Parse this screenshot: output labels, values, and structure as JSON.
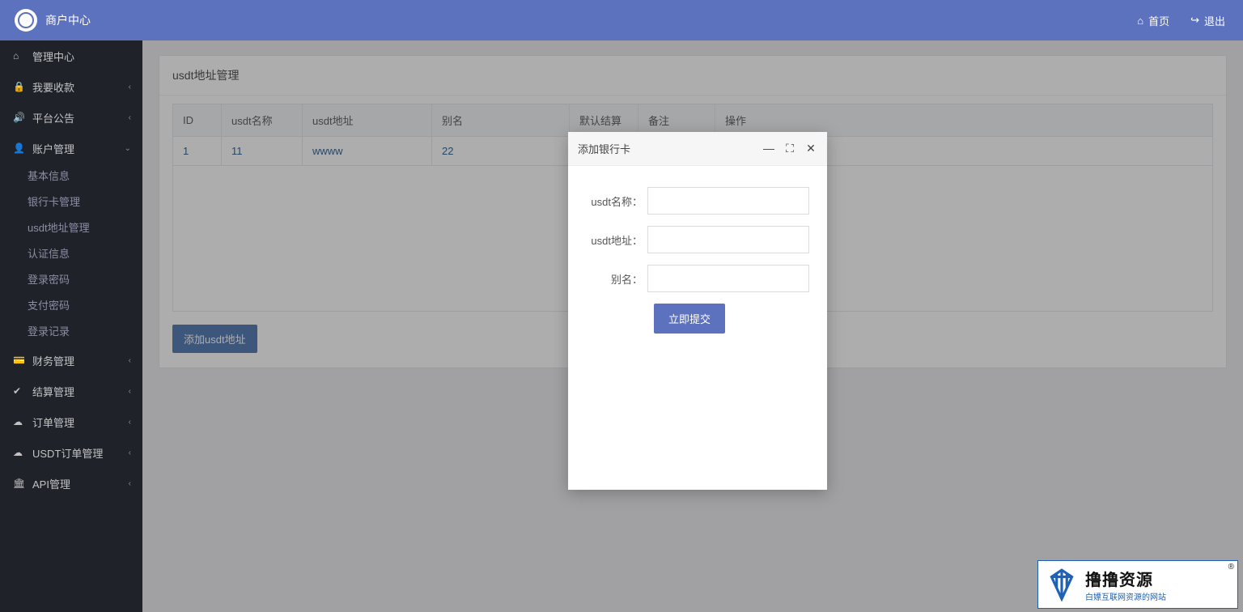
{
  "header": {
    "title": "商户中心",
    "home_label": "首页",
    "logout_label": "退出"
  },
  "sidebar": {
    "items": [
      {
        "icon": "⌂",
        "label": "管理中心",
        "chevron": ""
      },
      {
        "icon": "🔒",
        "label": "我要收款",
        "chevron": "‹"
      },
      {
        "icon": "🔊",
        "label": "平台公告",
        "chevron": "‹"
      },
      {
        "icon": "👤",
        "label": "账户管理",
        "chevron": "⌄"
      },
      {
        "icon": "💳",
        "label": "财务管理",
        "chevron": "‹"
      },
      {
        "icon": "✔",
        "label": "结算管理",
        "chevron": "‹"
      },
      {
        "icon": "☁",
        "label": "订单管理",
        "chevron": "‹"
      },
      {
        "icon": "☁",
        "label": "USDT订单管理",
        "chevron": "‹"
      },
      {
        "icon": "🏛",
        "label": "API管理",
        "chevron": "‹"
      }
    ],
    "acct_sub": [
      {
        "label": "基本信息"
      },
      {
        "label": "银行卡管理"
      },
      {
        "label": "usdt地址管理"
      },
      {
        "label": "认证信息"
      },
      {
        "label": "登录密码"
      },
      {
        "label": "支付密码"
      },
      {
        "label": "登录记录"
      }
    ]
  },
  "page": {
    "title": "usdt地址管理",
    "columns": {
      "id": "ID",
      "name": "usdt名称",
      "addr": "usdt地址",
      "alias": "别名",
      "default": "默认结算",
      "remark": "备注",
      "op": "操作"
    },
    "rows": [
      {
        "id": "1",
        "name": "11",
        "addr": "wwww",
        "alias": "22",
        "default": "",
        "remark": ""
      }
    ],
    "add_button": "添加usdt地址"
  },
  "dialog": {
    "title": "添加银行卡",
    "labels": {
      "name": "usdt名称：",
      "addr": "usdt地址：",
      "alias": "别名："
    },
    "values": {
      "name": "",
      "addr": "",
      "alias": ""
    },
    "submit": "立即提交"
  },
  "watermark": {
    "title": "撸撸资源",
    "sub": "白嫖互联网资源的网站",
    "reg": "®"
  }
}
